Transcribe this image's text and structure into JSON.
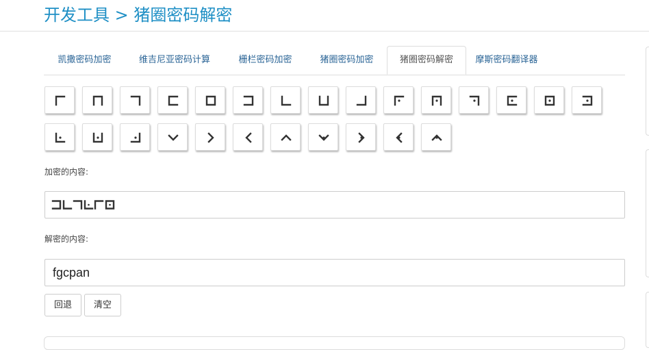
{
  "header": {
    "title": "开发工具 > 猪圈密码解密"
  },
  "tabs": [
    {
      "label": "凯撒密码加密",
      "active": false
    },
    {
      "label": "维吉尼亚密码计算",
      "active": false
    },
    {
      "label": "栅栏密码加密",
      "active": false
    },
    {
      "label": "猪圈密码加密",
      "active": false
    },
    {
      "label": "猪圈密码解密",
      "active": true
    },
    {
      "label": "摩斯密码翻译器",
      "active": false
    }
  ],
  "keyboard": {
    "row1": [
      "pigpen-a-icon",
      "pigpen-b-icon",
      "pigpen-c-icon",
      "pigpen-d-icon",
      "pigpen-e-icon",
      "pigpen-f-icon",
      "pigpen-g-icon",
      "pigpen-h-icon",
      "pigpen-i-icon",
      "pigpen-j-icon",
      "pigpen-k-icon",
      "pigpen-l-icon",
      "pigpen-m-icon",
      "pigpen-n-icon",
      "pigpen-o-icon"
    ],
    "row2": [
      "pigpen-p-icon",
      "pigpen-q-icon",
      "pigpen-r-icon",
      "pigpen-s-icon",
      "pigpen-t-icon",
      "pigpen-u-icon",
      "pigpen-v-icon",
      "pigpen-w-icon",
      "pigpen-x-icon",
      "pigpen-y-icon",
      "pigpen-z-icon"
    ]
  },
  "encrypted": {
    "label": "加密的内容:",
    "symbols": [
      "pigpen-f-icon",
      "pigpen-g-icon",
      "pigpen-c-icon",
      "pigpen-p-icon",
      "pigpen-a-icon",
      "pigpen-n-icon"
    ]
  },
  "decrypted": {
    "label": "解密的内容:",
    "value": "fgcpan"
  },
  "buttons": {
    "back": "回退",
    "clear": "清空"
  },
  "colors": {
    "accent": "#1e8fc5",
    "tab_link": "#2a6496",
    "glyph": "#333333"
  }
}
